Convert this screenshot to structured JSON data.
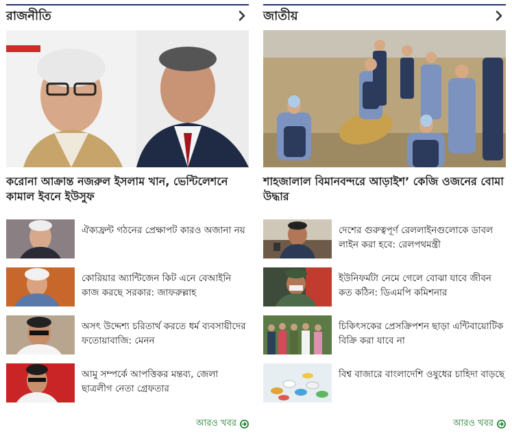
{
  "sections": [
    {
      "title": "রাজনীতি",
      "chevron_icon": "chevron-right-icon",
      "lead_title": "করোনা আক্রান্ত নজরুল ইসলাম খান, ভেন্টিলেশনে কামাল ইবনে ইউসুফ",
      "items": [
        {
          "title": "ঐক্যফ্রন্ট গঠনের প্রেক্ষাপট কারও অজানা নয়"
        },
        {
          "title": "কোরিয়ার অ্যান্টিজেন কিট এনে বেআইনি কাজ করছে সরকার: জাফরুল্লাহ"
        },
        {
          "title": "অসৎ উদ্দেশ্য চরিতার্থ করতে ধর্ম ব্যবসায়ীদের ফতোয়াবাজি: মেনন"
        },
        {
          "title": "আমু সম্পর্কে আপত্তিকর মন্তব্য, জেলা ছাত্রলীগ নেতা গ্রেফতার"
        }
      ],
      "more_label": "আরও খবর",
      "more_icon": "circle-arrow-right-icon"
    },
    {
      "title": "জাতীয়",
      "chevron_icon": "chevron-right-icon",
      "lead_title": "শাহজালাল বিমানবন্দরে আড়াইশ’ কেজি ওজনের বোমা উদ্ধার",
      "items": [
        {
          "title": "দেশের গুরুত্বপূর্ণ রেললাইনগুলোকে ডাবল লাইন করা হবে: রেলপথমন্ত্রী"
        },
        {
          "title": "ইউনিফর্মটা নেমে গেলে বোঝা যাবে জীবন কত কঠিন: ডিএমপি কমিশনার"
        },
        {
          "title": "চিকিৎসকের প্রেসক্রিপশন ছাড়া এন্টিবায়োটিক বিক্রি করা যাবে না"
        },
        {
          "title": "বিশ্ব বাজারে বাংলাদেশি ওষুধের চাহিদা বাড়ছে"
        }
      ],
      "more_label": "আরও খবর",
      "more_icon": "circle-arrow-right-icon"
    }
  ],
  "colors": {
    "header_rule": "#1e2f6b",
    "more_link": "#1a7a2a",
    "text": "#222222"
  }
}
